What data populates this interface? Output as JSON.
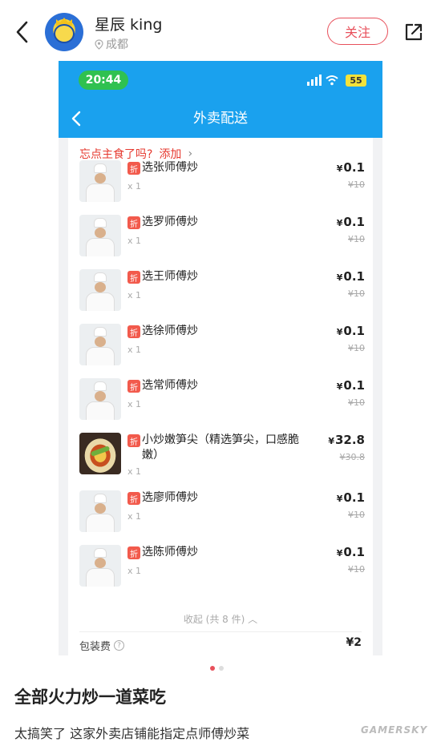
{
  "header": {
    "user_name": "星辰 king",
    "location": "成都",
    "follow_label": "关注"
  },
  "phone": {
    "status_time": "20:44",
    "battery": "55",
    "nav_title": "外卖配送",
    "addon_prompt": "忘点主食了吗?",
    "addon_link": "添加",
    "items": [
      {
        "name": "选张师傅炒",
        "qty": "x 1",
        "price": "0.1",
        "original": "¥10",
        "type": "chef"
      },
      {
        "name": "选罗师傅炒",
        "qty": "x 1",
        "price": "0.1",
        "original": "¥10",
        "type": "chef"
      },
      {
        "name": "选王师傅炒",
        "qty": "x 1",
        "price": "0.1",
        "original": "¥10",
        "type": "chef"
      },
      {
        "name": "选徐师傅炒",
        "qty": "x 1",
        "price": "0.1",
        "original": "¥10",
        "type": "chef"
      },
      {
        "name": "选常师傅炒",
        "qty": "x 1",
        "price": "0.1",
        "original": "¥10",
        "type": "chef"
      },
      {
        "name": "小炒嫩笋尖（精选笋尖，口感脆嫩）",
        "qty": "x 1",
        "price": "32.8",
        "original": "¥30.8",
        "type": "food"
      },
      {
        "name": "选廖师傅炒",
        "qty": "x 1",
        "price": "0.1",
        "original": "¥10",
        "type": "chef"
      },
      {
        "name": "选陈师傅炒",
        "qty": "x 1",
        "price": "0.1",
        "original": "¥10",
        "type": "chef"
      }
    ],
    "discount_tag": "折",
    "currency": "¥",
    "collapse_label": "收起 (共 8 件)",
    "packing_label": "包装费",
    "packing_price": "¥2"
  },
  "post": {
    "title": "全部火力炒一道菜吃",
    "body": "太搞笑了 这家外卖店铺能指定点师傅炒菜",
    "watermark": "GAMERSKY"
  },
  "colors": {
    "accent_red": "#e8505b",
    "app_blue": "#1aa1ee"
  }
}
